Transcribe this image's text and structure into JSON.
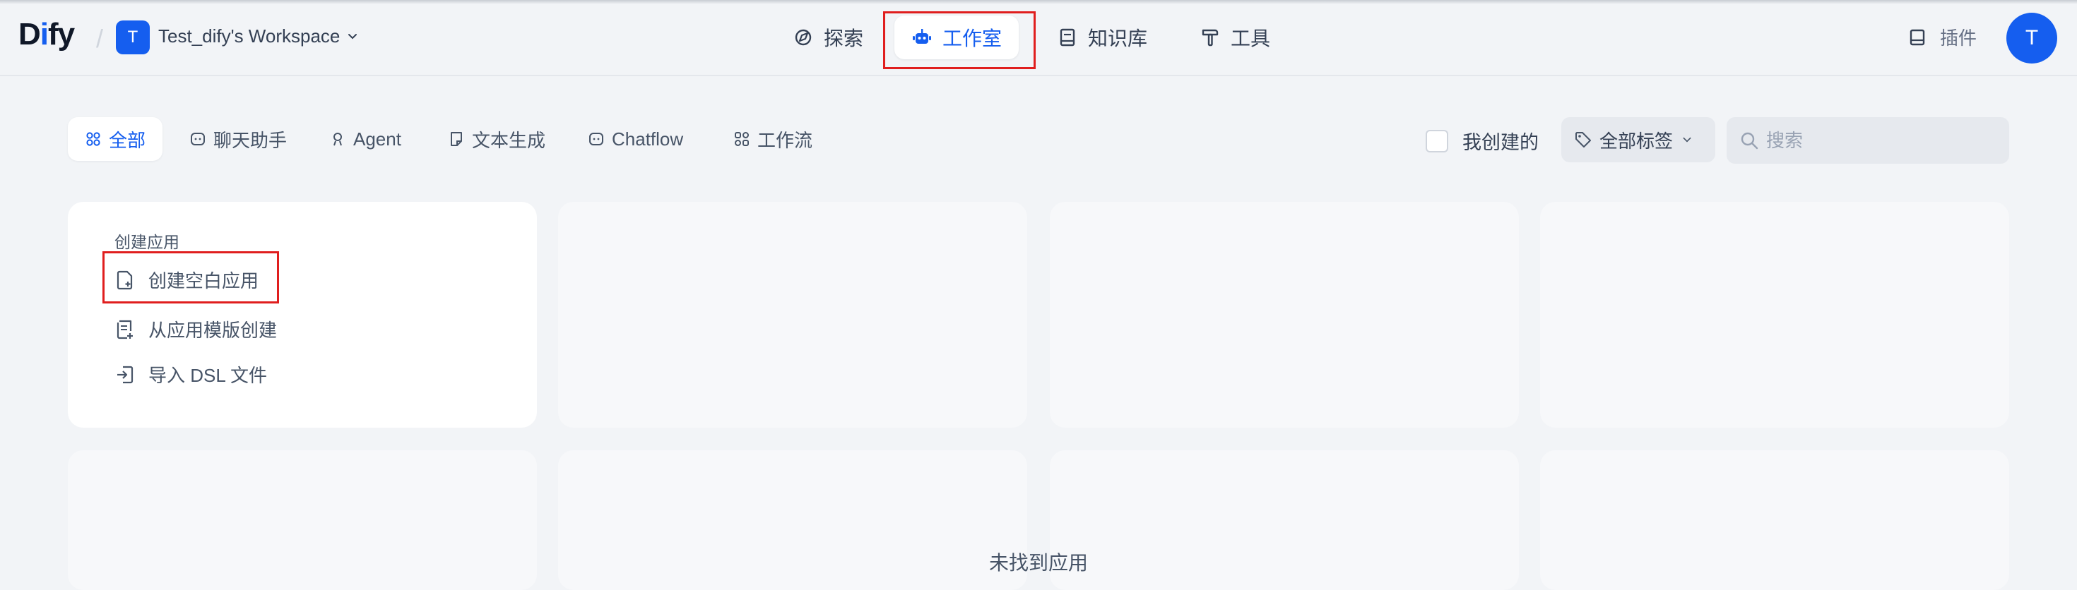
{
  "header": {
    "logo_main": "D",
    "logo_i": "i",
    "logo_rest": "fy",
    "workspace_initial": "T",
    "workspace_name": "Test_dify's Workspace",
    "nav": [
      {
        "label": "探索",
        "icon": "explore-icon"
      },
      {
        "label": "工作室",
        "icon": "robot-icon",
        "active": true
      },
      {
        "label": "知识库",
        "icon": "book-icon"
      },
      {
        "label": "工具",
        "icon": "hammer-icon"
      }
    ],
    "plugins_label": "插件",
    "user_initial": "T"
  },
  "filters": {
    "tabs": [
      {
        "label": "全部",
        "icon": "grid-icon",
        "active": true
      },
      {
        "label": "聊天助手",
        "icon": "chat-icon"
      },
      {
        "label": "Agent",
        "icon": "agent-icon"
      },
      {
        "label": "文本生成",
        "icon": "doc-icon"
      },
      {
        "label": "Chatflow",
        "icon": "chatflow-icon"
      },
      {
        "label": "工作流",
        "icon": "workflow-icon"
      }
    ],
    "mine_label": "我创建的",
    "tags_label": "全部标签",
    "search_placeholder": "搜索"
  },
  "create_card": {
    "title": "创建应用",
    "items": [
      {
        "label": "创建空白应用",
        "icon": "new-file-icon"
      },
      {
        "label": "从应用模版创建",
        "icon": "template-icon"
      },
      {
        "label": "导入 DSL 文件",
        "icon": "import-icon"
      }
    ]
  },
  "empty_state": "未找到应用",
  "colors": {
    "accent": "#155eef",
    "background": "#f2f4f7",
    "highlight": "#e01e1e"
  }
}
